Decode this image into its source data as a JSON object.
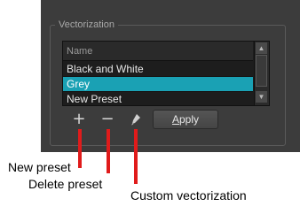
{
  "vectorization": {
    "title": "Vectorization",
    "list": {
      "header": "Name",
      "items": [
        {
          "label": "Black and White",
          "selected": false
        },
        {
          "label": "Grey",
          "selected": true
        },
        {
          "label": "New Preset",
          "selected": false
        }
      ]
    },
    "toolbar": {
      "new_icon": "+",
      "delete_icon": "−",
      "custom_icon": "pencil-icon"
    },
    "apply": {
      "first": "A",
      "rest": "pply"
    }
  },
  "callouts": {
    "new_preset": "New preset",
    "delete_preset": "Delete preset",
    "custom_vectorization": "Custom vectorization"
  },
  "colors": {
    "panel": "#3c3c3c",
    "selection": "#1aa1b4",
    "pointer": "#e01b1b"
  }
}
